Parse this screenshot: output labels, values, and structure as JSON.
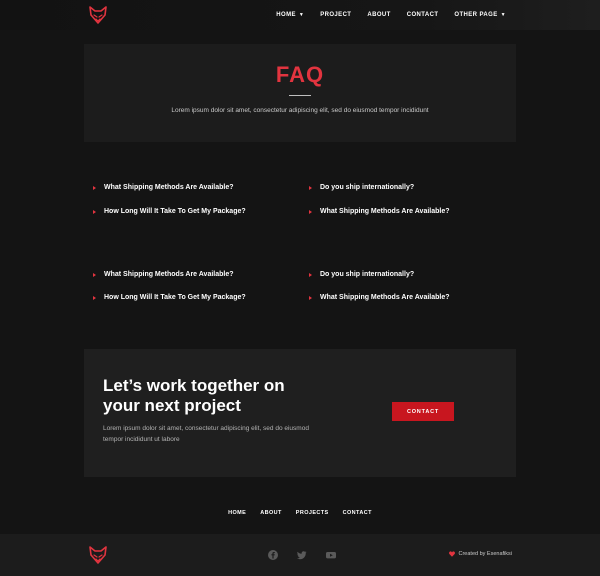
{
  "header": {
    "logo_icon": "fox-head-icon",
    "nav": [
      {
        "label": "HOME",
        "dropdown": true
      },
      {
        "label": "PROJECT",
        "dropdown": false
      },
      {
        "label": "ABOUT",
        "dropdown": false
      },
      {
        "label": "CONTACT",
        "dropdown": false
      },
      {
        "label": "OTHER PAGE",
        "dropdown": true
      }
    ]
  },
  "hero": {
    "title": "FAQ",
    "subtitle": "Lorem ipsum dolor sit amet, consectetur adipiscing elit, sed do eiusmod tempor incididunt"
  },
  "faq": {
    "group1": {
      "left": [
        "What Shipping Methods Are Available?",
        "How Long Will It Take To Get My Package?"
      ],
      "right": [
        "Do you ship internationally?",
        "What Shipping Methods Are Available?"
      ]
    },
    "group2": {
      "left": [
        "What Shipping Methods Are Available?",
        "How Long Will It Take To Get My Package?"
      ],
      "right": [
        "Do you ship internationally?",
        "What Shipping Methods Are Available?"
      ]
    }
  },
  "cta": {
    "title_line1": "Let’s work together on",
    "title_line2": "your next project",
    "text_line1": "Lorem ipsum dolor sit amet, consectetur adipiscing elit, sed do eiusmod",
    "text_line2": "tempor incididunt ut labore",
    "button_label": "CONTACT"
  },
  "footer": {
    "nav": [
      "HOME",
      "ABOUT",
      "PROJECTS",
      "CONTACT"
    ],
    "socials": [
      "facebook-icon",
      "twitter-icon",
      "youtube-icon"
    ],
    "credit": "Created by Esenafiksi"
  },
  "colors": {
    "accent": "#e2343f",
    "button": "#c8161f",
    "background": "#141414",
    "panel": "#1c1c1c"
  }
}
